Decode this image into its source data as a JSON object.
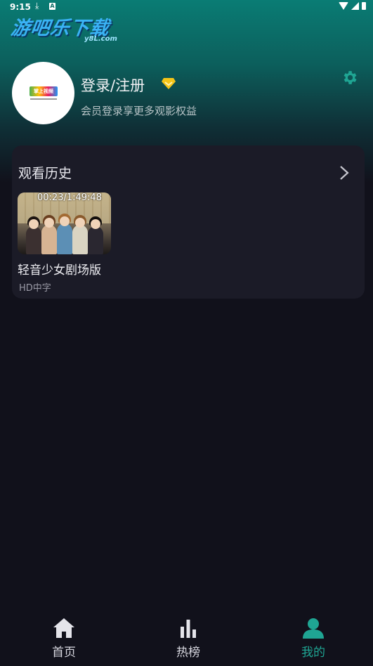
{
  "status_bar": {
    "time": "9:15"
  },
  "watermark": {
    "main": "游吧乐下载",
    "sub": "y8L.com"
  },
  "profile": {
    "login_title": "登录/注册",
    "member_tip": "会员登录享更多观影权益"
  },
  "history": {
    "title": "观看历史",
    "items": [
      {
        "progress": "00:23/1:49:48",
        "title": "轻音少女剧场版",
        "badge": "HD中字"
      }
    ]
  },
  "nav": {
    "items": [
      {
        "label": "首页",
        "icon": "home-icon",
        "active": false
      },
      {
        "label": "热榜",
        "icon": "chart-icon",
        "active": false
      },
      {
        "label": "我的",
        "icon": "user-icon",
        "active": true
      }
    ]
  },
  "colors": {
    "accent": "#1fa593",
    "background": "#11111b",
    "card": "#1b1b27",
    "vip": "#f5c518"
  }
}
